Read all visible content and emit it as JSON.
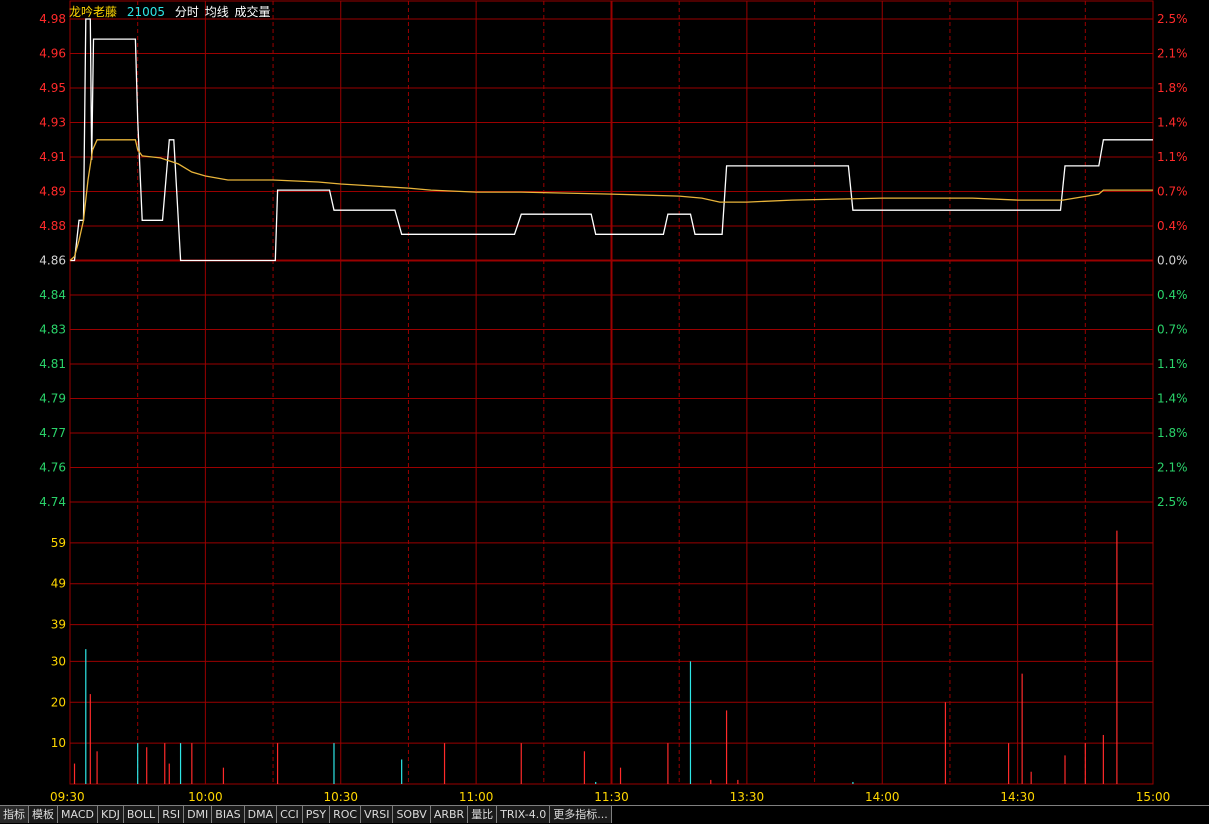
{
  "header": {
    "stock_name": "龙吟老藤",
    "code": "21005",
    "labels": [
      "分时",
      "均线",
      "成交量"
    ]
  },
  "colors": {
    "background": "#000000",
    "grid": "#9a0000",
    "price_line": "#ffffff",
    "avg_line": "#e8b43a",
    "up": "#ff2a2a",
    "down": "#2ad36a",
    "flat": "#d0d0d0",
    "volume_up": "#ff2a2a",
    "volume_down": "#2ee6e6",
    "volume_axis": "#ffd700",
    "header_name": "#ffd700",
    "header_code": "#2ee6e6",
    "header_labels": "#ffffff"
  },
  "tabs": [
    "指标",
    "模板",
    "MACD",
    "KDJ",
    "BOLL",
    "RSI",
    "DMI",
    "BIAS",
    "DMA",
    "CCI",
    "PSY",
    "ROC",
    "VRSI",
    "SOBV",
    "ARBR",
    "量比",
    "TRIX-4.0",
    "更多指标..."
  ],
  "chart_data": {
    "type": "line",
    "price_axis": {
      "ticks": [
        "4.98",
        "4.96",
        "4.95",
        "4.93",
        "4.91",
        "4.89",
        "4.88",
        "4.86",
        "4.84",
        "4.83",
        "4.81",
        "4.79",
        "4.77",
        "4.76",
        "4.74"
      ],
      "ylim": [
        4.74,
        4.98
      ],
      "reference_price": 4.86
    },
    "percent_axis": {
      "ticks": [
        "2.5%",
        "2.1%",
        "1.8%",
        "1.4%",
        "1.1%",
        "0.7%",
        "0.4%",
        "0.0%",
        "0.4%",
        "0.7%",
        "1.1%",
        "1.4%",
        "1.8%",
        "2.1%",
        "2.5%"
      ]
    },
    "volume_axis": {
      "ticks": [
        "59",
        "49",
        "39",
        "30",
        "20",
        "10"
      ],
      "ylim": [
        0,
        69
      ]
    },
    "time_axis": {
      "ticks": [
        "09:30",
        "10:00",
        "10:30",
        "11:00",
        "11:30",
        "13:30",
        "14:00",
        "14:30",
        "15:00"
      ],
      "minutes": [
        0,
        30,
        60,
        90,
        120,
        150,
        180,
        210,
        240
      ]
    },
    "series": [
      {
        "key": "price",
        "points": [
          [
            0,
            4.86
          ],
          [
            1,
            4.86
          ],
          [
            2,
            4.88
          ],
          [
            3,
            4.88
          ],
          [
            3.5,
            4.98
          ],
          [
            4.5,
            4.98
          ],
          [
            4.8,
            4.91
          ],
          [
            5.2,
            4.97
          ],
          [
            14.5,
            4.97
          ],
          [
            15,
            4.93
          ],
          [
            16,
            4.88
          ],
          [
            20.5,
            4.88
          ],
          [
            22,
            4.92
          ],
          [
            23,
            4.92
          ],
          [
            24.5,
            4.86
          ],
          [
            45.5,
            4.86
          ],
          [
            46,
            4.895
          ],
          [
            57.5,
            4.895
          ],
          [
            58.5,
            4.885
          ],
          [
            72,
            4.885
          ],
          [
            73.5,
            4.873
          ],
          [
            98.5,
            4.873
          ],
          [
            100,
            4.883
          ],
          [
            115.5,
            4.883
          ],
          [
            116.5,
            4.873
          ],
          [
            131.5,
            4.873
          ],
          [
            132.5,
            4.883
          ],
          [
            137.5,
            4.883
          ],
          [
            138.5,
            4.873
          ],
          [
            144.5,
            4.873
          ],
          [
            145.5,
            4.907
          ],
          [
            172.5,
            4.907
          ],
          [
            173.5,
            4.885
          ],
          [
            219.5,
            4.885
          ],
          [
            220.5,
            4.907
          ],
          [
            228,
            4.907
          ],
          [
            229,
            4.92
          ],
          [
            240,
            4.92
          ]
        ]
      },
      {
        "key": "average",
        "points": [
          [
            0,
            4.86
          ],
          [
            1,
            4.862
          ],
          [
            2,
            4.87
          ],
          [
            3,
            4.88
          ],
          [
            4,
            4.9
          ],
          [
            5,
            4.915
          ],
          [
            6,
            4.92
          ],
          [
            14.5,
            4.92
          ],
          [
            15,
            4.915
          ],
          [
            16,
            4.912
          ],
          [
            20,
            4.911
          ],
          [
            24,
            4.908
          ],
          [
            27,
            4.904
          ],
          [
            30,
            4.902
          ],
          [
            35,
            4.9
          ],
          [
            45,
            4.9
          ],
          [
            55,
            4.899
          ],
          [
            60,
            4.898
          ],
          [
            75,
            4.896
          ],
          [
            80,
            4.895
          ],
          [
            90,
            4.894
          ],
          [
            100,
            4.894
          ],
          [
            120,
            4.893
          ],
          [
            135,
            4.892
          ],
          [
            140,
            4.891
          ],
          [
            144,
            4.889
          ],
          [
            150,
            4.889
          ],
          [
            160,
            4.89
          ],
          [
            180,
            4.891
          ],
          [
            200,
            4.891
          ],
          [
            210,
            4.89
          ],
          [
            220,
            4.89
          ],
          [
            228,
            4.893
          ],
          [
            229,
            4.895
          ],
          [
            240,
            4.895
          ]
        ]
      }
    ],
    "volume": [
      {
        "t": 1,
        "v": 5,
        "dir": "up"
      },
      {
        "t": 3.5,
        "v": 33,
        "dir": "down"
      },
      {
        "t": 4.5,
        "v": 22,
        "dir": "up"
      },
      {
        "t": 6,
        "v": 8,
        "dir": "up"
      },
      {
        "t": 15,
        "v": 10,
        "dir": "down"
      },
      {
        "t": 17,
        "v": 9,
        "dir": "up"
      },
      {
        "t": 21,
        "v": 10,
        "dir": "up"
      },
      {
        "t": 22,
        "v": 5,
        "dir": "up"
      },
      {
        "t": 24.5,
        "v": 10,
        "dir": "down"
      },
      {
        "t": 27,
        "v": 10,
        "dir": "up"
      },
      {
        "t": 34,
        "v": 4,
        "dir": "up"
      },
      {
        "t": 46,
        "v": 10,
        "dir": "up"
      },
      {
        "t": 58.5,
        "v": 10,
        "dir": "down"
      },
      {
        "t": 73.5,
        "v": 6,
        "dir": "down"
      },
      {
        "t": 83,
        "v": 10,
        "dir": "up"
      },
      {
        "t": 100,
        "v": 10,
        "dir": "up"
      },
      {
        "t": 114,
        "v": 8,
        "dir": "up"
      },
      {
        "t": 116.5,
        "v": 0.5,
        "dir": "down"
      },
      {
        "t": 122,
        "v": 4,
        "dir": "up"
      },
      {
        "t": 132.5,
        "v": 10,
        "dir": "up"
      },
      {
        "t": 137.5,
        "v": 30,
        "dir": "down"
      },
      {
        "t": 142,
        "v": 1,
        "dir": "up"
      },
      {
        "t": 145.5,
        "v": 18,
        "dir": "up"
      },
      {
        "t": 148,
        "v": 1,
        "dir": "up"
      },
      {
        "t": 173.5,
        "v": 0.5,
        "dir": "down"
      },
      {
        "t": 194,
        "v": 20,
        "dir": "up"
      },
      {
        "t": 208,
        "v": 10,
        "dir": "up"
      },
      {
        "t": 211,
        "v": 27,
        "dir": "up"
      },
      {
        "t": 213,
        "v": 3,
        "dir": "up"
      },
      {
        "t": 220.5,
        "v": 7,
        "dir": "up"
      },
      {
        "t": 225,
        "v": 10,
        "dir": "up"
      },
      {
        "t": 229,
        "v": 12,
        "dir": "up"
      },
      {
        "t": 232,
        "v": 62,
        "dir": "up"
      }
    ]
  }
}
